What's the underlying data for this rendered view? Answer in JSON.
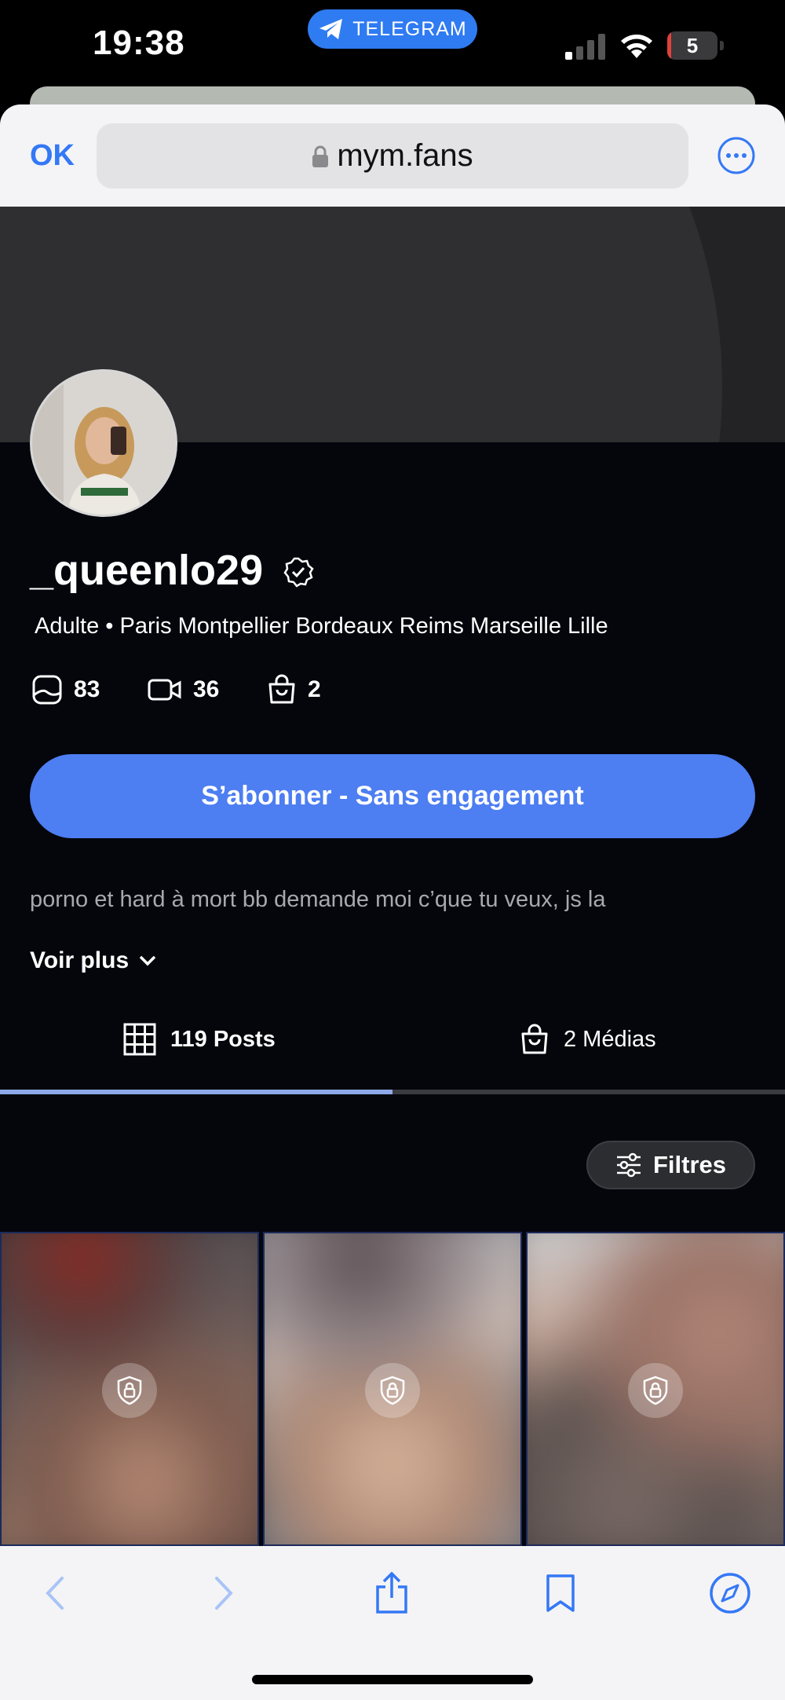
{
  "status_bar": {
    "time": "19:38",
    "app_pill": "TELEGRAM",
    "battery_level": "5",
    "battery_fraction": 0.05,
    "colors": {
      "telegram_pill": "#2f7bf2",
      "battery_low": "#e0423b"
    }
  },
  "browser": {
    "ok_label": "OK",
    "url": "mym.fans",
    "icons": [
      "lock-icon",
      "more-icon"
    ]
  },
  "profile": {
    "username": "_queenlo29",
    "subtitle": "Adulte • Paris Montpellier Bordeaux Reims Marseille Lille",
    "stats": [
      {
        "icon": "photo-icon",
        "value": "83"
      },
      {
        "icon": "video-icon",
        "value": "36"
      },
      {
        "icon": "bag-icon",
        "value": "2"
      }
    ],
    "subscribe_label": "S’abonner - Sans engagement",
    "bio": "porno et hard à mort bb demande moi c’que tu veux, js la",
    "voir_plus_label": "Voir plus"
  },
  "tabs": [
    {
      "label": "119 Posts",
      "icon": "grid-icon",
      "active": true
    },
    {
      "label": "2 Médias",
      "icon": "bag-icon",
      "active": false
    }
  ],
  "filters_label": "Filtres",
  "posts": [
    {
      "locked": true
    },
    {
      "locked": true
    },
    {
      "locked": true
    }
  ],
  "toolbar": {
    "icons": [
      "back-icon",
      "forward-icon",
      "share-icon",
      "bookmarks-icon",
      "compass-icon"
    ]
  },
  "colors": {
    "accent": "#4d7ef2",
    "page_bg": "#05060c",
    "browser_blue": "#3478f6"
  }
}
